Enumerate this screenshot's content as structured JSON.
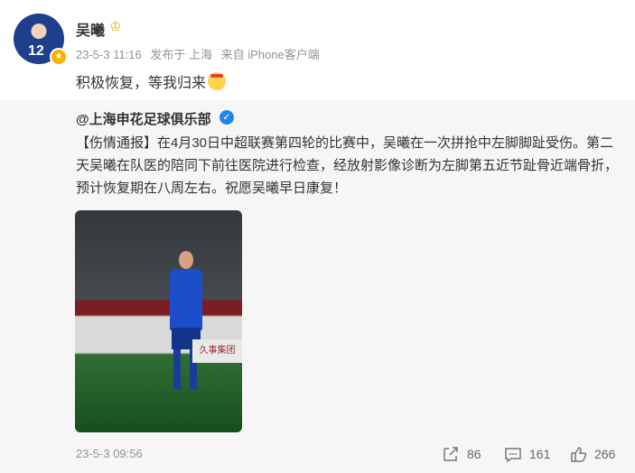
{
  "user": {
    "name": "吴曦"
  },
  "meta": {
    "time": "23-5-3 11:16",
    "publish": "发布于 上海",
    "source": "来自 iPhone客户端"
  },
  "post": {
    "text": "积极恢复，等我归来"
  },
  "repost": {
    "author": "@上海申花足球俱乐部",
    "body": "【伤情通报】在4月30日中超联赛第四轮的比赛中，吴曦在一次拼抢中左脚脚趾受伤。第二天吴曦在队医的陪同下前往医院进行检查，经放射影像诊断为左脚第五近节趾骨近端骨折，预计恢复期在八周左右。祝愿吴曦早日康复！",
    "image_sign": "久事集团",
    "time": "23-5-3 09:56",
    "forwards": "86",
    "comments": "161",
    "likes": "266"
  },
  "avatar": {
    "number": "12"
  },
  "icons": {
    "forward": "share-icon",
    "comment": "comment-icon",
    "like": "thumb-up-icon"
  },
  "colors": {
    "text": "#333333",
    "meta": "#939393",
    "repost_bg": "#f6f6f6",
    "verified": "#1e88e5"
  }
}
